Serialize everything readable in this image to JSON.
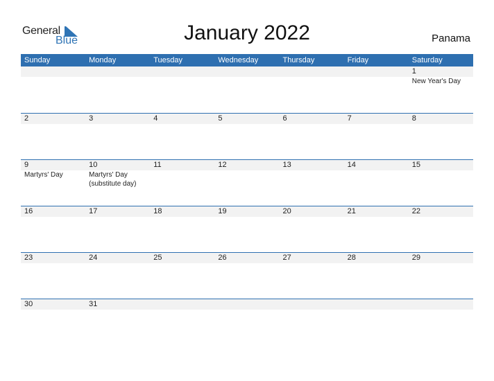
{
  "header": {
    "logo_general": "General",
    "logo_blue": "Blue",
    "title": "January 2022",
    "country": "Panama"
  },
  "colors": {
    "accent": "#2e6fb0",
    "band": "#f2f2f2"
  },
  "weekdays": [
    "Sunday",
    "Monday",
    "Tuesday",
    "Wednesday",
    "Thursday",
    "Friday",
    "Saturday"
  ],
  "weeks": [
    [
      {
        "day": "",
        "event": ""
      },
      {
        "day": "",
        "event": ""
      },
      {
        "day": "",
        "event": ""
      },
      {
        "day": "",
        "event": ""
      },
      {
        "day": "",
        "event": ""
      },
      {
        "day": "",
        "event": ""
      },
      {
        "day": "1",
        "event": "New Year's Day"
      }
    ],
    [
      {
        "day": "2",
        "event": ""
      },
      {
        "day": "3",
        "event": ""
      },
      {
        "day": "4",
        "event": ""
      },
      {
        "day": "5",
        "event": ""
      },
      {
        "day": "6",
        "event": ""
      },
      {
        "day": "7",
        "event": ""
      },
      {
        "day": "8",
        "event": ""
      }
    ],
    [
      {
        "day": "9",
        "event": "Martyrs' Day"
      },
      {
        "day": "10",
        "event": "Martyrs' Day (substitute day)"
      },
      {
        "day": "11",
        "event": ""
      },
      {
        "day": "12",
        "event": ""
      },
      {
        "day": "13",
        "event": ""
      },
      {
        "day": "14",
        "event": ""
      },
      {
        "day": "15",
        "event": ""
      }
    ],
    [
      {
        "day": "16",
        "event": ""
      },
      {
        "day": "17",
        "event": ""
      },
      {
        "day": "18",
        "event": ""
      },
      {
        "day": "19",
        "event": ""
      },
      {
        "day": "20",
        "event": ""
      },
      {
        "day": "21",
        "event": ""
      },
      {
        "day": "22",
        "event": ""
      }
    ],
    [
      {
        "day": "23",
        "event": ""
      },
      {
        "day": "24",
        "event": ""
      },
      {
        "day": "25",
        "event": ""
      },
      {
        "day": "26",
        "event": ""
      },
      {
        "day": "27",
        "event": ""
      },
      {
        "day": "28",
        "event": ""
      },
      {
        "day": "29",
        "event": ""
      }
    ],
    [
      {
        "day": "30",
        "event": ""
      },
      {
        "day": "31",
        "event": ""
      },
      {
        "day": "",
        "event": ""
      },
      {
        "day": "",
        "event": ""
      },
      {
        "day": "",
        "event": ""
      },
      {
        "day": "",
        "event": ""
      },
      {
        "day": "",
        "event": ""
      }
    ]
  ]
}
